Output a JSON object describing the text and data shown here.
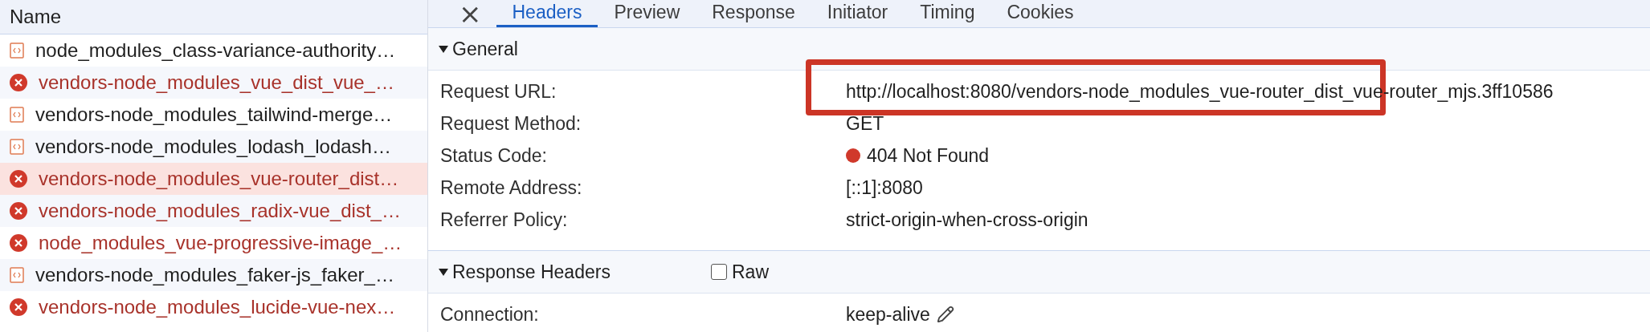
{
  "request_list": {
    "column": "Name",
    "rows": [
      {
        "name": "node_modules_class-variance-authority…",
        "kind": "script",
        "failed": false,
        "selected": false
      },
      {
        "name": "vendors-node_modules_vue_dist_vue_…",
        "kind": "error",
        "failed": true,
        "selected": false
      },
      {
        "name": "vendors-node_modules_tailwind-merge…",
        "kind": "script",
        "failed": false,
        "selected": false
      },
      {
        "name": "vendors-node_modules_lodash_lodash…",
        "kind": "script",
        "failed": false,
        "selected": false
      },
      {
        "name": "vendors-node_modules_vue-router_dist…",
        "kind": "error",
        "failed": true,
        "selected": true
      },
      {
        "name": "vendors-node_modules_radix-vue_dist_…",
        "kind": "error",
        "failed": true,
        "selected": false
      },
      {
        "name": "node_modules_vue-progressive-image_…",
        "kind": "error",
        "failed": true,
        "selected": false
      },
      {
        "name": "vendors-node_modules_faker-js_faker_…",
        "kind": "script",
        "failed": false,
        "selected": false
      },
      {
        "name": "vendors-node_modules_lucide-vue-nex…",
        "kind": "error",
        "failed": true,
        "selected": false
      }
    ]
  },
  "details": {
    "close": "×",
    "tabs": [
      {
        "label": "Headers",
        "selected": true
      },
      {
        "label": "Preview",
        "selected": false
      },
      {
        "label": "Response",
        "selected": false
      },
      {
        "label": "Initiator",
        "selected": false
      },
      {
        "label": "Timing",
        "selected": false
      },
      {
        "label": "Cookies",
        "selected": false
      }
    ],
    "sections": [
      {
        "title": "General",
        "expanded": true,
        "rows": [
          {
            "label": "Request URL:",
            "value": "http://localhost:8080/vendors-node_modules_vue-router_dist_vue-router_mjs.3ff10586",
            "highlighted": true
          },
          {
            "label": "Request Method:",
            "value": "GET",
            "highlighted": false
          },
          {
            "label": "Status Code:",
            "value": "404 Not Found",
            "color": "#d0392b",
            "highlighted": false
          },
          {
            "label": "Remote Address:",
            "value": "[::1]:8080",
            "highlighted": false
          },
          {
            "label": "Referrer Policy:",
            "value": "strict-origin-when-cross-origin",
            "highlighted": false
          }
        ]
      },
      {
        "title": "Response Headers",
        "expanded": true,
        "raw": {
          "label": "Raw",
          "checked": false
        },
        "rows": [
          {
            "label": "Connection:",
            "value": "keep-alive",
            "editable": true,
            "highlighted": false
          }
        ]
      }
    ]
  }
}
